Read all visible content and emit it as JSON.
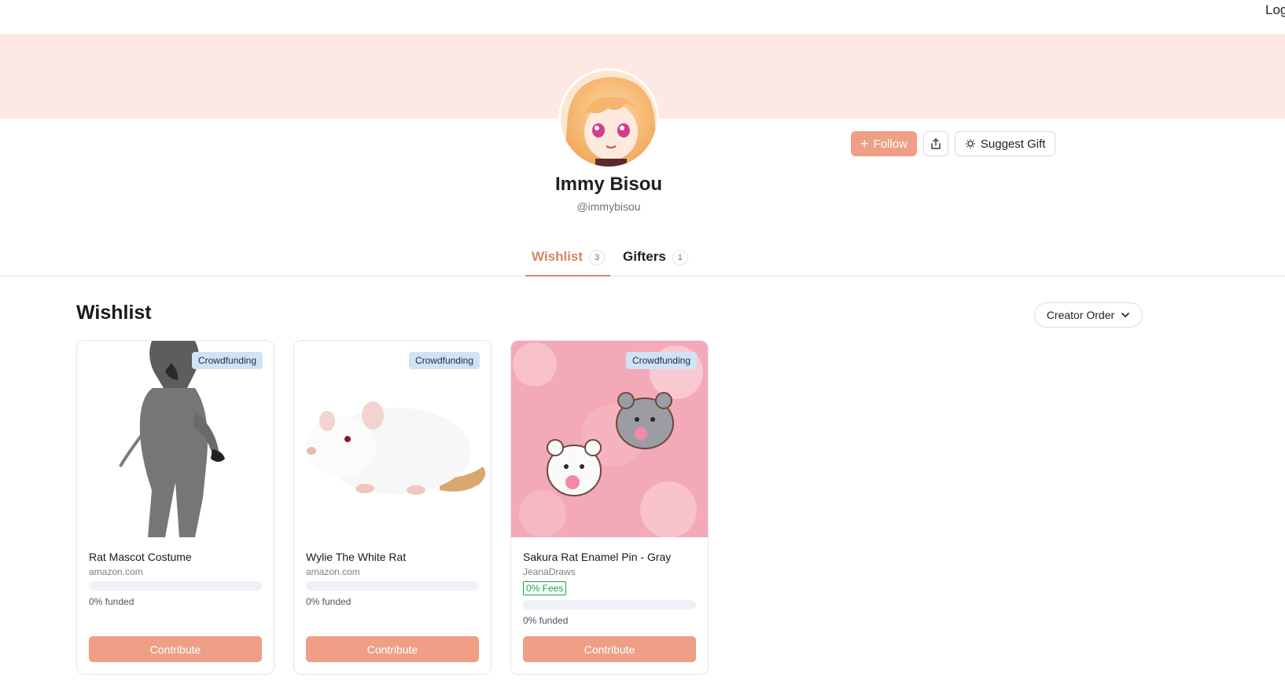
{
  "header": {
    "login_label": "Log"
  },
  "profile": {
    "name": "Immy Bisou",
    "handle": "@immybisou",
    "follow_label": "Follow",
    "suggest_label": "Suggest Gift"
  },
  "tabs": [
    {
      "label": "Wishlist",
      "count": "3",
      "active": true
    },
    {
      "label": "Gifters",
      "count": "1",
      "active": false
    }
  ],
  "wishlist": {
    "title": "Wishlist",
    "sort_label": "Creator Order",
    "items": [
      {
        "title": "Rat Mascot Costume",
        "source": "amazon.com",
        "badge": "Crowdfunding",
        "funded_label": "0% funded",
        "funded_fraction": 0,
        "contribute_label": "Contribute"
      },
      {
        "title": "Wylie The White Rat",
        "source": "amazon.com",
        "badge": "Crowdfunding",
        "funded_label": "0% funded",
        "funded_fraction": 0,
        "contribute_label": "Contribute"
      },
      {
        "title": "Sakura Rat Enamel Pin - Gray",
        "source": "JeanaDraws",
        "fees_label": "0% Fees",
        "badge": "Crowdfunding",
        "funded_label": "0% funded",
        "funded_fraction": 0,
        "contribute_label": "Contribute"
      }
    ]
  },
  "colors": {
    "accent": "#ef9f86",
    "tab_active": "#d98468",
    "banner": "#fde8e3",
    "badge_bg": "#cfe3f5",
    "fees_green": "#16a34a"
  }
}
